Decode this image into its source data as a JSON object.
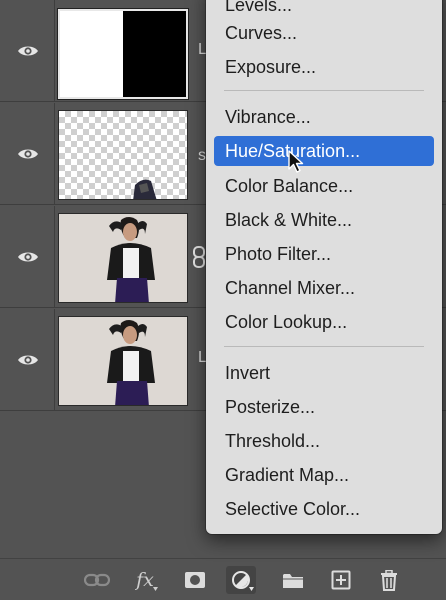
{
  "layers": [
    {
      "name": "layer-mask-adjustment",
      "label_fragment": "L",
      "thumb": "mask"
    },
    {
      "name": "layer-transparent",
      "label_fragment": "s",
      "thumb": "transparent"
    },
    {
      "name": "layer-photo-linked",
      "label_fragment": "",
      "thumb": "photo"
    },
    {
      "name": "layer-photo-base",
      "label_fragment": "L",
      "thumb": "photo"
    }
  ],
  "menu": {
    "items": [
      "Levels...",
      "Curves...",
      "Exposure...",
      "Vibrance...",
      "Hue/Saturation...",
      "Color Balance...",
      "Black & White...",
      "Photo Filter...",
      "Channel Mixer...",
      "Color Lookup...",
      "Invert",
      "Posterize...",
      "Threshold...",
      "Gradient Map...",
      "Selective Color..."
    ],
    "highlighted_index": 4
  },
  "toolbar": {
    "icons": [
      "link-icon",
      "fx-icon",
      "mask-icon",
      "adjustment-layer-icon",
      "folder-icon",
      "new-layer-icon",
      "trash-icon"
    ],
    "fx_label": "fx"
  },
  "colors": {
    "panel_bg": "#535353",
    "menu_bg": "#dedede",
    "highlight": "#2f6fd6"
  }
}
